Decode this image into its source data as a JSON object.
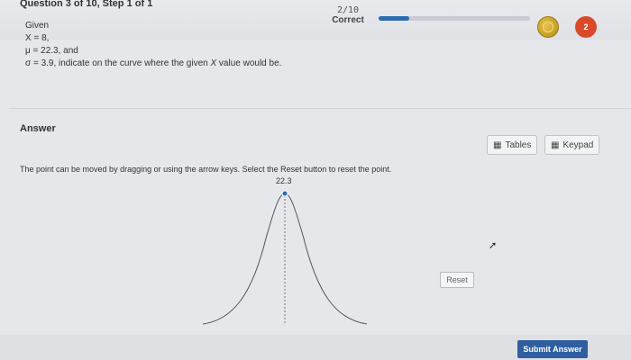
{
  "header": {
    "question_title": "Question 3 of 10, Step 1 of 1",
    "score_fraction": "2/10",
    "score_label": "Correct",
    "progress_fraction": 0.2,
    "hearts_count": "2"
  },
  "given": {
    "label": "Given",
    "x_line": "X = 8,",
    "mu_line": "μ = 22.3, and",
    "sigma_prefix": "σ = 3.9, indicate on the curve where the given ",
    "sigma_var": "X",
    "sigma_suffix": " value would be."
  },
  "answer": {
    "label": "Answer",
    "tables_label": "Tables",
    "keypad_label": "Keypad",
    "instructions": "The point can be moved by dragging or using the arrow keys. Select the Reset button to reset the point.",
    "curve_value_label": "22.3",
    "reset_label": "Reset"
  },
  "footer": {
    "submit_label": "Submit Answer"
  },
  "colors": {
    "accent": "#2f5fa0",
    "progress": "#2b6cb0",
    "heart": "#d94a2a"
  }
}
